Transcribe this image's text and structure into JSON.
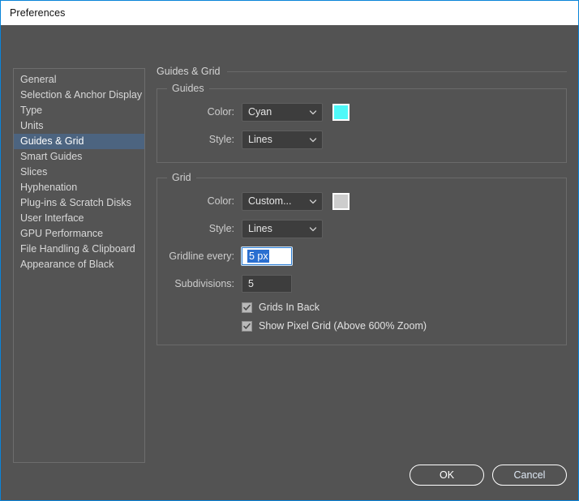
{
  "window": {
    "title": "Preferences"
  },
  "sidebar": {
    "items": [
      {
        "label": "General",
        "selected": false
      },
      {
        "label": "Selection & Anchor Display",
        "selected": false
      },
      {
        "label": "Type",
        "selected": false
      },
      {
        "label": "Units",
        "selected": false
      },
      {
        "label": "Guides & Grid",
        "selected": true
      },
      {
        "label": "Smart Guides",
        "selected": false
      },
      {
        "label": "Slices",
        "selected": false
      },
      {
        "label": "Hyphenation",
        "selected": false
      },
      {
        "label": "Plug-ins & Scratch Disks",
        "selected": false
      },
      {
        "label": "User Interface",
        "selected": false
      },
      {
        "label": "GPU Performance",
        "selected": false
      },
      {
        "label": "File Handling & Clipboard",
        "selected": false
      },
      {
        "label": "Appearance of Black",
        "selected": false
      }
    ]
  },
  "pane": {
    "title": "Guides & Grid",
    "guides": {
      "legend": "Guides",
      "color_label": "Color:",
      "color_value": "Cyan",
      "color_swatch": "#4ff9f9",
      "style_label": "Style:",
      "style_value": "Lines"
    },
    "grid": {
      "legend": "Grid",
      "color_label": "Color:",
      "color_value": "Custom...",
      "color_swatch": "#cdcdcd",
      "style_label": "Style:",
      "style_value": "Lines",
      "gridline_label": "Gridline every:",
      "gridline_value": "5 px",
      "subdivisions_label": "Subdivisions:",
      "subdivisions_value": "5",
      "grids_in_back_label": "Grids In Back",
      "grids_in_back_checked": true,
      "pixel_grid_label": "Show Pixel Grid (Above 600% Zoom)",
      "pixel_grid_checked": true
    }
  },
  "footer": {
    "ok_label": "OK",
    "cancel_label": "Cancel"
  },
  "icons": {
    "chevron_down": "chevron-down-icon",
    "check": "check-icon"
  }
}
